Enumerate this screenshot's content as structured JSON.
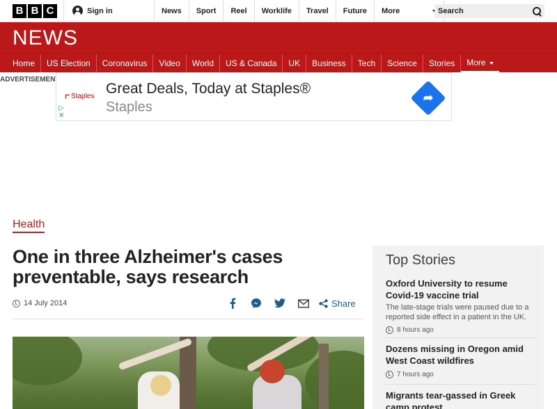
{
  "global_nav": {
    "logo_letters": [
      "B",
      "B",
      "C"
    ],
    "sign_in": "Sign in",
    "items": [
      "News",
      "Sport",
      "Reel",
      "Worklife",
      "Travel",
      "Future"
    ],
    "more": "More",
    "search_placeholder": "Search"
  },
  "news_header": {
    "logo": "NEWS",
    "nav_items": [
      "Home",
      "US Election",
      "Coronavirus",
      "Video",
      "World",
      "US & Canada",
      "UK",
      "Business",
      "Tech",
      "Science",
      "Stories"
    ],
    "more": "More"
  },
  "advertisement": {
    "label": "ADVERTISEMENT",
    "brand": "Staples",
    "title": "Great Deals, Today at Staples®",
    "subtitle": "Staples"
  },
  "article": {
    "section": "Health",
    "headline": "One in three Alzheimer's cases preventable, says research",
    "date": "14 July 2014",
    "share_label": "Share",
    "share_icons": [
      "facebook-icon",
      "messenger-icon",
      "twitter-icon",
      "email-icon",
      "share-icon"
    ],
    "colors": {
      "brand_red": "#bb1919",
      "share_blue": "#1d5e8e"
    }
  },
  "top_stories": {
    "title": "Top Stories",
    "items": [
      {
        "headline": "Oxford University to resume Covid-19 vaccine trial",
        "summary": "The late-stage trials were paused due to a reported side effect in a patient in the UK.",
        "time": "8 hours ago"
      },
      {
        "headline": "Dozens missing in Oregon amid West Coast wildfires",
        "summary": "",
        "time": "7 hours ago"
      },
      {
        "headline": "Migrants tear-gassed in Greek camp protest",
        "summary": "",
        "time": ""
      }
    ]
  }
}
